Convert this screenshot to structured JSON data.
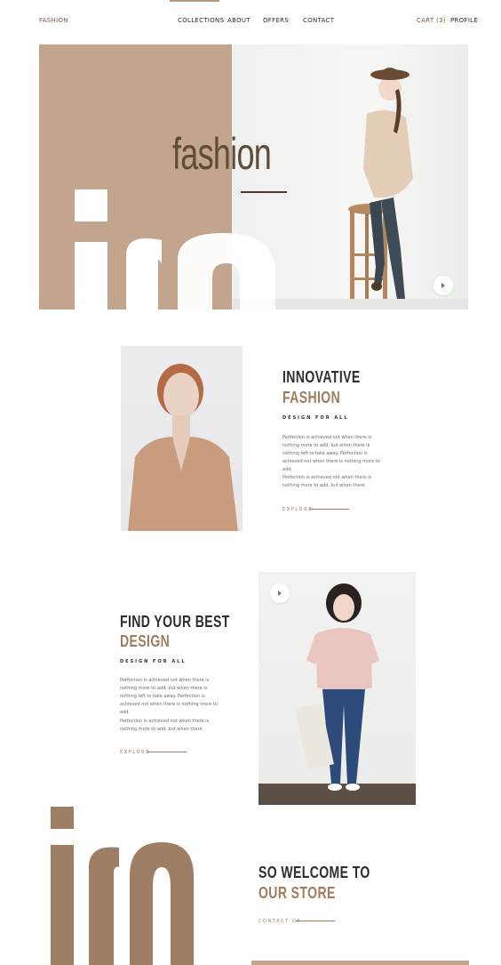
{
  "nav": {
    "brand": "FASHION",
    "links": [
      "COLLECTIONS",
      "ABOUT",
      "OFFERS",
      "CONTACT"
    ],
    "cart": "CART (3)",
    "profile": "PROFILE"
  },
  "hero": {
    "word": "fashion",
    "play_icon": "play-icon"
  },
  "section1": {
    "title1": "INNOVATIVE",
    "title2": "FASHION",
    "subtitle": "DESIGN FOR ALL",
    "para1": "Perfection is achieved not when there is nothing more to add, but when there is nothing left to take away. Perfection is achieved not when there is nothing more to add.",
    "para2": "Perfection is achieved not when there is nothing more to add, but when there.",
    "cta": "EXPLORE"
  },
  "section2": {
    "title1": "FIND YOUR BEST",
    "title2": "DESIGN",
    "subtitle": "DESIGN FOR ALL",
    "para1": "Perfection is achieved not when there is nothing more to add, but when there is nothing left to take away. Perfection is achieved not when there is nothing more to add.",
    "para2": "Perfection is achieved not when there is nothing more to add, but when there.",
    "cta": "EXPLORE",
    "play_icon": "play-icon"
  },
  "section3": {
    "title1": "SO WELCOME TO",
    "title2": "OUR STORE",
    "cta": "CONTACT US"
  },
  "colors": {
    "tan": "#c3a58d",
    "brown_accent": "#a07c5c",
    "dark_text": "#2d2d33",
    "big_letter_brown": "#9e7f66"
  }
}
